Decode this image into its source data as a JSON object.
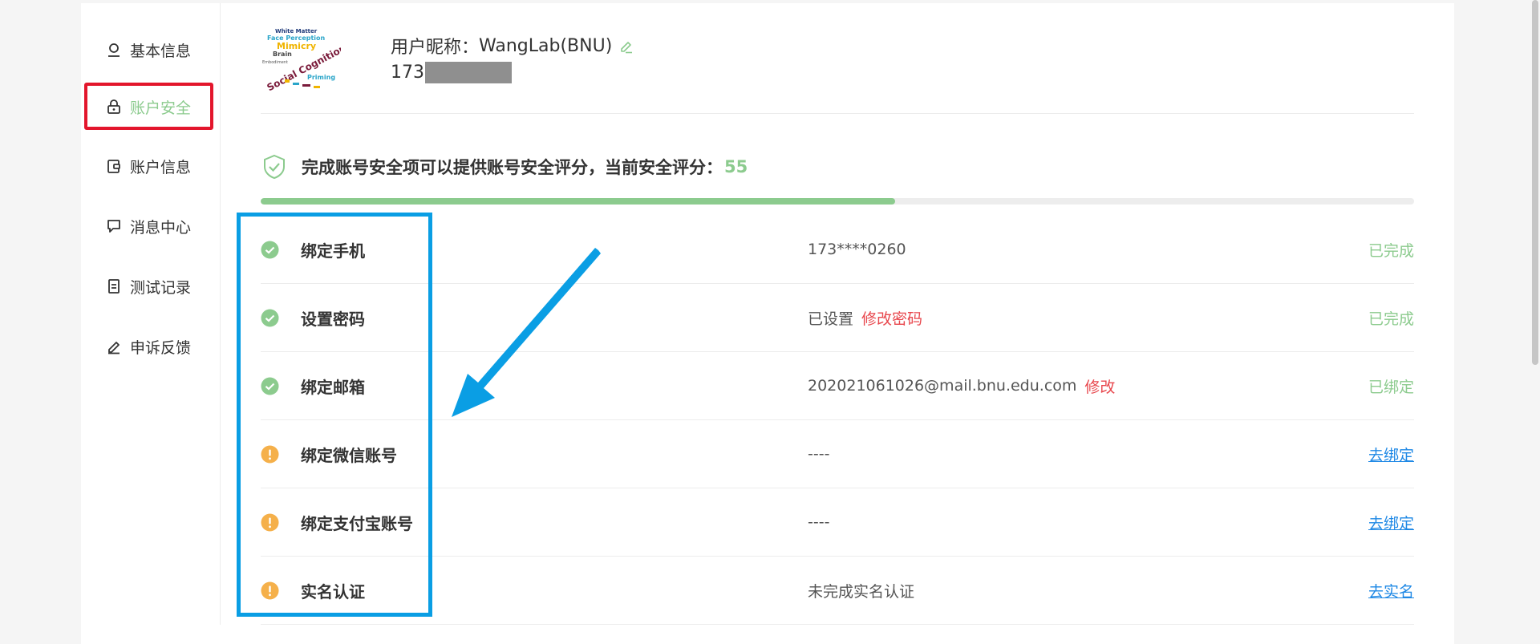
{
  "sidebar": {
    "items": [
      {
        "label": "基本信息",
        "icon": "user-icon"
      },
      {
        "label": "账户安全",
        "icon": "lock-icon",
        "active": true
      },
      {
        "label": "账户信息",
        "icon": "wallet-icon"
      },
      {
        "label": "消息中心",
        "icon": "message-icon"
      },
      {
        "label": "测试记录",
        "icon": "document-icon"
      },
      {
        "label": "申诉反馈",
        "icon": "edit-icon"
      }
    ]
  },
  "profile": {
    "nickname_prefix": "用户昵称：",
    "nickname": "WangLab(BNU)",
    "phone_visible": "173",
    "avatar_words": [
      "White Matter",
      "Face Perception",
      "Mimicry",
      "Brain",
      "Social Cognition",
      "Priming",
      "Embodiment"
    ]
  },
  "security": {
    "score_text": "完成账号安全项可以提供账号安全评分，当前安全评分：",
    "score": "55",
    "score_fraction": 0.55
  },
  "items": [
    {
      "label": "绑定手机",
      "value": "173****0260",
      "action": "",
      "status": "已完成",
      "state": "done"
    },
    {
      "label": "设置密码",
      "value": "已设置",
      "action": "修改密码",
      "status": "已完成",
      "state": "done"
    },
    {
      "label": "绑定邮箱",
      "value": "202021061026@mail.bnu.edu.com",
      "action": "修改",
      "status": "已绑定",
      "state": "done"
    },
    {
      "label": "绑定微信账号",
      "value": "----",
      "action": "",
      "status": "去绑定",
      "state": "todo"
    },
    {
      "label": "绑定支付宝账号",
      "value": "----",
      "action": "",
      "status": "去绑定",
      "state": "todo"
    },
    {
      "label": "实名认证",
      "value": "未完成实名认证",
      "action": "",
      "status": "去实名",
      "state": "todo"
    }
  ],
  "colors": {
    "accent_green": "#8ccb8e",
    "warning_orange": "#f5b04a",
    "link_blue": "#1e88e5",
    "action_red": "#e8474d",
    "annotation_red": "#e3162c",
    "annotation_blue": "#0a9ee4"
  }
}
